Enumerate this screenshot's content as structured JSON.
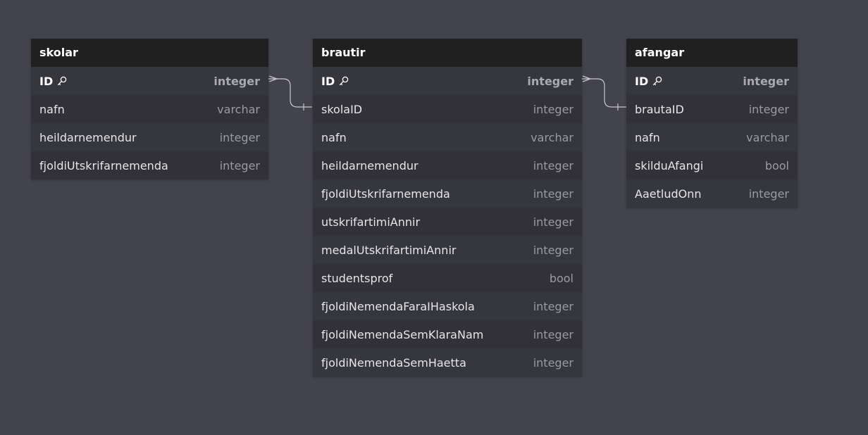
{
  "tables": [
    {
      "name": "skolar",
      "fields": [
        {
          "name": "ID",
          "type": "integer",
          "pk": true
        },
        {
          "name": "nafn",
          "type": "varchar"
        },
        {
          "name": "heildarnemendur",
          "type": "integer"
        },
        {
          "name": "fjoldiUtskrifarnemenda",
          "type": "integer"
        }
      ]
    },
    {
      "name": "brautir",
      "fields": [
        {
          "name": "ID",
          "type": "integer",
          "pk": true
        },
        {
          "name": "skolaID",
          "type": "integer"
        },
        {
          "name": "nafn",
          "type": "varchar"
        },
        {
          "name": "heildarnemendur",
          "type": "integer"
        },
        {
          "name": "fjoldiUtskrifarnemenda",
          "type": "integer"
        },
        {
          "name": "utskrifartimiAnnir",
          "type": "integer"
        },
        {
          "name": "medalUtskrifartimiAnnir",
          "type": "integer"
        },
        {
          "name": "studentsprof",
          "type": "bool"
        },
        {
          "name": "fjoldiNemendaFaraIHaskola",
          "type": "integer"
        },
        {
          "name": "fjoldiNemendaSemKlaraNam",
          "type": "integer"
        },
        {
          "name": "fjoldiNemendaSemHaetta",
          "type": "integer"
        }
      ]
    },
    {
      "name": "afangar",
      "fields": [
        {
          "name": "ID",
          "type": "integer",
          "pk": true
        },
        {
          "name": "brautaID",
          "type": "integer"
        },
        {
          "name": "nafn",
          "type": "varchar"
        },
        {
          "name": "skilduAfangi",
          "type": "bool"
        },
        {
          "name": "AaetludOnn",
          "type": "integer"
        }
      ]
    }
  ],
  "relations": [
    {
      "from": "skolar.ID",
      "to": "brautir.skolaID",
      "from_end": "many",
      "to_end": "one"
    },
    {
      "from": "brautir.ID",
      "to": "afangar.brautaID",
      "from_end": "many",
      "to_end": "one"
    }
  ],
  "colors": {
    "background": "#43434d",
    "header": "#202021",
    "connector": "#c8c8cc"
  }
}
